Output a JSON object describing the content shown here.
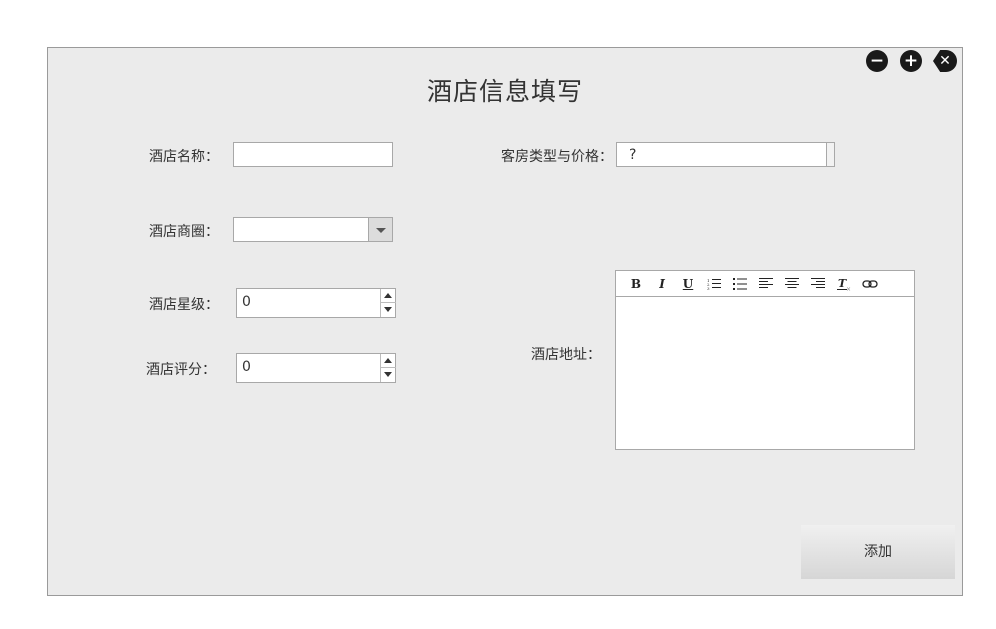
{
  "window": {
    "title": "酒店信息填写",
    "controls": {
      "minimize_icon": "−",
      "maximize_icon": "+",
      "close_icon": "✕"
    }
  },
  "form": {
    "hotel_name_label": "酒店名称：",
    "hotel_name_value": "",
    "room_type_label": "客房类型与价格：",
    "room_type_value": "?",
    "business_district_label": "酒店商圈：",
    "business_district_value": "",
    "star_label": "酒店星级：",
    "star_value": "0",
    "rating_label": "酒店评分：",
    "rating_value": "0",
    "address_label": "酒店地址：",
    "address_value": ""
  },
  "editor_toolbar": {
    "bold": "B",
    "italic": "I",
    "underline": "U"
  },
  "actions": {
    "add_label": "添加"
  }
}
